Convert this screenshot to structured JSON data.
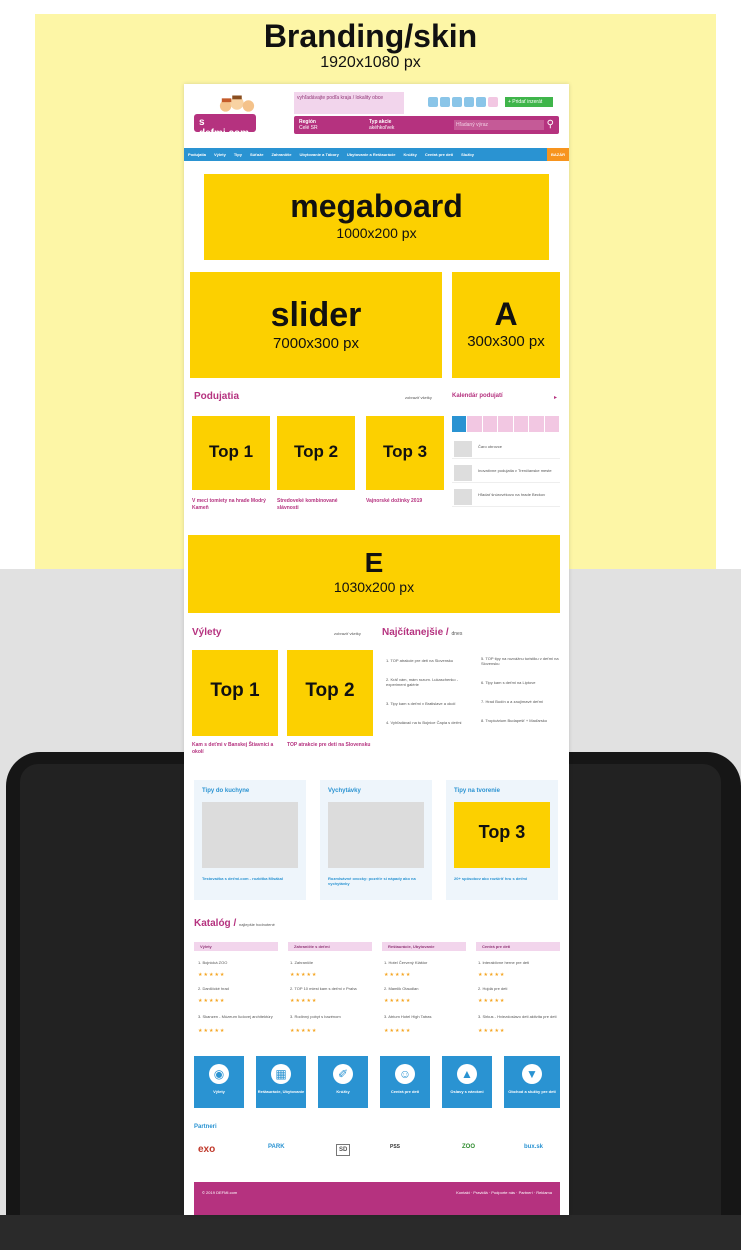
{
  "header": {
    "title": "Branding/skin",
    "subtitle": "1920x1080 px"
  },
  "site": {
    "logo": "s defmi.com",
    "promo_text": "vyhľadávajte podľa kraja / lokality obce",
    "cta": "+ Pridať inzerát",
    "search": {
      "region_label": "Región",
      "region_value": "Celé SR",
      "type_label": "Typ akcie",
      "type_value": "akéhkoľvek",
      "placeholder": "Hľadaný výraz"
    },
    "nav": [
      "Podujatia",
      "Výlety",
      "Tipy",
      "Súťaže",
      "Zahraničie",
      "Ubytovanie a Tábory",
      "Ubytovanie a Reštaurácie",
      "Krúžky",
      "Centrá pre deti",
      "Služby",
      "BAZÁR"
    ],
    "ads": {
      "megaboard": {
        "name": "megaboard",
        "size": "1000x200 px"
      },
      "slider": {
        "name": "slider",
        "size": "7000x300 px"
      },
      "a": {
        "name": "A",
        "size": "300x300 px"
      },
      "e": {
        "name": "E",
        "size": "1030x200 px"
      }
    },
    "podujatia": {
      "title": "Podujatia",
      "link": "zobraziť všetky",
      "tiles": [
        {
          "label": "Top 1",
          "caption": "V meci tomiety na hrade Modrý Kameň"
        },
        {
          "label": "Top 2",
          "caption": "Stredoveké kombinované slávnosti"
        },
        {
          "label": "Top 3",
          "caption": "Vajnorské dožinky 2019"
        }
      ]
    },
    "kalendar": {
      "title": "Kalendár podujatí",
      "items": [
        "Čaro obrovce",
        "Inovatívne podujatia v Trenčianske meste",
        "Hľadať šnúrovékovo na hrade Beckov"
      ]
    },
    "vylety": {
      "title": "Výlety",
      "link": "zobraziť všetky",
      "tiles": [
        {
          "label": "Top 1",
          "caption": "Kam s deťmi v Banskej Štiavnici a okolí"
        },
        {
          "label": "Top 2",
          "caption": "TOP atrakcie pre deti na Slovensku"
        }
      ]
    },
    "najcitanejsie": {
      "title": "Najčítanejšie /",
      "sub": "dnes",
      "items_left": [
        "1. TOP atrakcie pre deti na Slovensku",
        "2. Kráľ vám, mám rozum. Lukaschenko - experiment galérie",
        "3. Tipy kam s deťmi v Bratislave a okolí",
        "4. Vyhľadávač na tu Bojnice Čapia s deťmi"
      ],
      "items_right": [
        "5. TOP tipy na rozvážnu turistiku v deťmi na Slovensku",
        "6. Tipy kam s deťmi na Liptove",
        "7. Hrad Budín a a zaujímavé deťmi",
        "8. Tropicárium Budapešť + Maďarsko"
      ]
    },
    "topics": [
      {
        "title": "Tipy do kuchyne",
        "caption": "Testovačka s deťmi.com - rozbitka Mlsákal"
      },
      {
        "title": "Vychytávky",
        "caption": "Rozmlsávné ovocky: pozriťe si nápady ako na vychytávky"
      },
      {
        "title": "Tipy na tvorenie",
        "label": "Top 3",
        "caption": "20+ spôsobov ako rozšíriť hru s deťmi"
      }
    ],
    "katalog": {
      "title": "Katalóg /",
      "sub": "najlepšie hodnotené",
      "columns": [
        {
          "head": "Výlety",
          "items": [
            "1. Bojnická ZOO",
            "2. Danlčické hrad",
            "3. Skanzen - Múzeum ľudovej architektúry"
          ]
        },
        {
          "head": "Zahraničie s deťmi",
          "items": [
            "1. Zahraničie",
            "2. TOP 10 miest kam s deťmi v Praha",
            "3. Rodinný pobyt s bazénom"
          ]
        },
        {
          "head": "Reštaurácie, Ubytovanie",
          "items": [
            "1. Hotel Červený Kláštor",
            "2. Mamlik Otaudlan",
            "3. Atrium Hotel High Tatras"
          ]
        },
        {
          "head": "Centrá pre deti",
          "items": [
            "1. Interaktívne herne pre deti",
            "2. Hojdá pre deti",
            "3. Sirkus - Hviezdoslavo deti aktivita pre deti"
          ]
        }
      ],
      "stars": "★★★★★"
    },
    "icon_tiles": [
      "Výlety",
      "Reštaurácie, Ubytovanie",
      "Krúžky",
      "Centrá pre deti",
      "Oslavy s nárokmi",
      "Obchod a služby pre deti"
    ],
    "partneri": {
      "title": "Partneri",
      "logos": [
        "exo",
        "PARK",
        "SD",
        "PSS",
        "ZOO",
        "bux.sk"
      ]
    },
    "footer": {
      "left": "© 2019 DEFMI.com",
      "links": [
        "Kontakt",
        "Pravidlá",
        "Podporte nás",
        "Partneri",
        "Reklama"
      ]
    }
  }
}
